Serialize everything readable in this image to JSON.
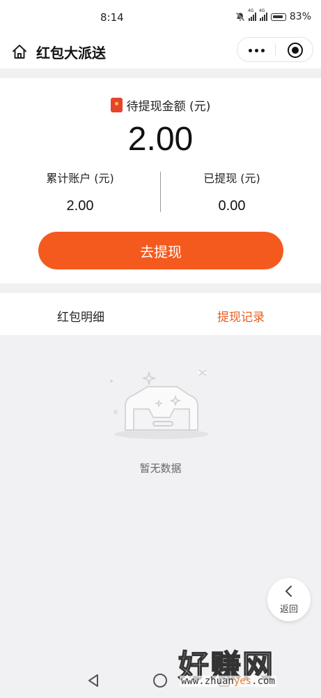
{
  "status_bar": {
    "time": "8:14",
    "network_1": "4G",
    "network_2": "4G",
    "battery": "83%"
  },
  "nav": {
    "title": "红包大派送",
    "icons": [
      "home-icon",
      "more-dots-icon",
      "target-icon"
    ]
  },
  "summary": {
    "pending_label": "待提现金额 (元)",
    "pending_amount": "2.00",
    "total_label": "累计账户 (元)",
    "total_value": "2.00",
    "withdrawn_label": "已提现 (元)",
    "withdrawn_value": "0.00",
    "withdraw_button": "去提现"
  },
  "tabs": {
    "details": "红包明细",
    "records": "提现记录",
    "active": "records"
  },
  "empty": {
    "text": "暂无数据"
  },
  "floating": {
    "back_label": "返回"
  },
  "watermark": {
    "title": "好赚网",
    "url_prefix": "www.zhuan",
    "url_highlight": "yes",
    "url_suffix": ".com"
  },
  "colors": {
    "accent": "#f45a1e",
    "active_tab": "#ec5b1d",
    "redpack": "#e5432c"
  }
}
